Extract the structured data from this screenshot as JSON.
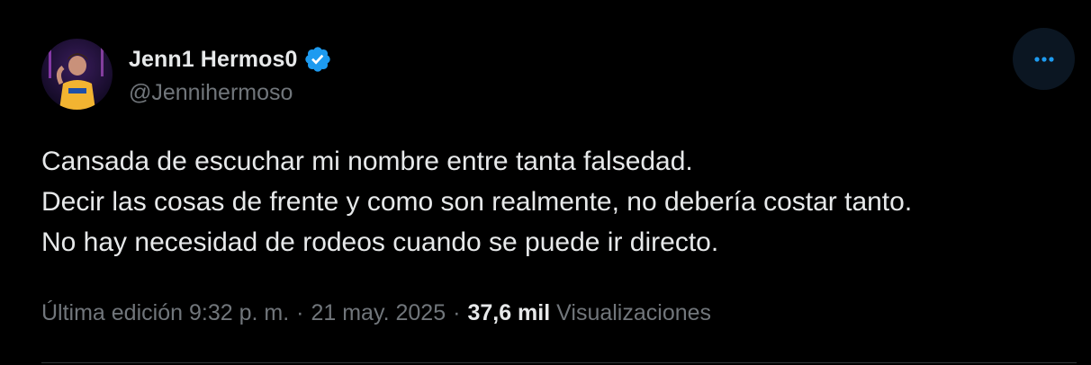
{
  "tweet": {
    "author": {
      "display_name": "Jenn1 Hermos0",
      "handle": "@Jennihermoso",
      "verified": true,
      "verified_color": "#1d9bf0"
    },
    "more_icon": "more-horizontal-icon",
    "accent_color": "#1d9bf0",
    "body_lines": [
      "Cansada de escuchar mi nombre entre tanta falsedad.",
      "Decir las cosas de frente y como son realmente, no debería costar tanto.",
      "No hay necesidad de rodeos cuando se puede ir directo."
    ],
    "meta": {
      "edited_label": "Última edición",
      "time": "9:32 p. m.",
      "separator": "·",
      "date": "21 may. 2025",
      "views_count": "37,6 mil",
      "views_label": "Visualizaciones"
    }
  }
}
